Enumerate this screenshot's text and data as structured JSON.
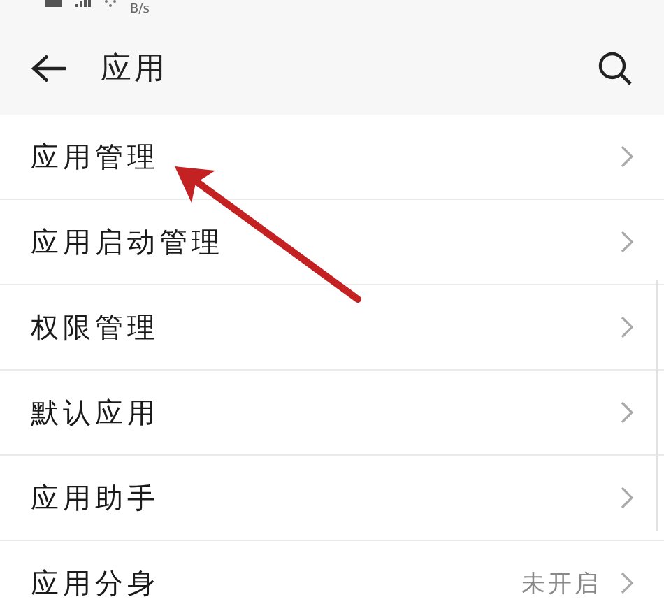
{
  "status_bar": {
    "speed_unit": "B/s"
  },
  "header": {
    "title": "应用"
  },
  "items": [
    {
      "label": "应用管理"
    },
    {
      "label": "应用启动管理"
    },
    {
      "label": "权限管理"
    },
    {
      "label": "默认应用"
    },
    {
      "label": "应用助手"
    },
    {
      "label": "应用分身",
      "value": "未开启"
    }
  ]
}
